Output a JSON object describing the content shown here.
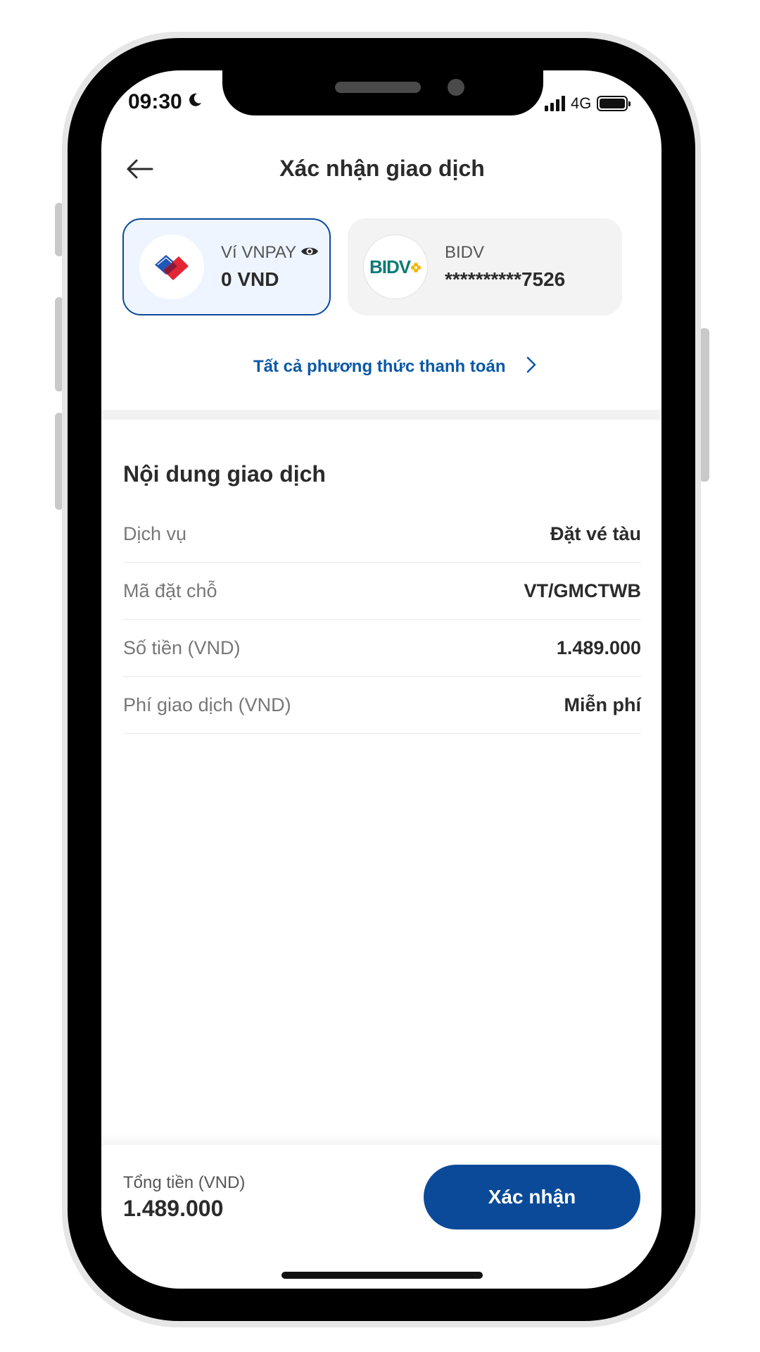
{
  "status_bar": {
    "time": "09:30",
    "network": "4G"
  },
  "header": {
    "title": "Xác nhận giao dịch",
    "back_icon": "arrow-left-icon"
  },
  "payment_methods": [
    {
      "name": "Ví VNPAY",
      "value": "0 VND",
      "selected": true,
      "logo": "vnpay-logo"
    },
    {
      "name": "BIDV",
      "value": "**********7526",
      "selected": false,
      "logo_text": "BIDV"
    }
  ],
  "all_methods_link": "Tất cả phương thức thanh toán",
  "details": {
    "title": "Nội dung giao dịch",
    "rows": [
      {
        "label": "Dịch vụ",
        "value": "Đặt vé tàu"
      },
      {
        "label": "Mã đặt chỗ",
        "value": "VT/GMCTWB"
      },
      {
        "label": "Số tiền (VND)",
        "value": "1.489.000"
      },
      {
        "label": "Phí giao dịch (VND)",
        "value": "Miễn phí"
      }
    ]
  },
  "footer": {
    "total_label": "Tổng tiền (VND)",
    "total_value": "1.489.000",
    "confirm_label": "Xác nhận"
  },
  "colors": {
    "primary": "#0b4a98",
    "link": "#0b58a6",
    "selected_bg": "#eef5ff",
    "bidv_green": "#0d7a74",
    "bidv_gold": "#f4b400"
  }
}
